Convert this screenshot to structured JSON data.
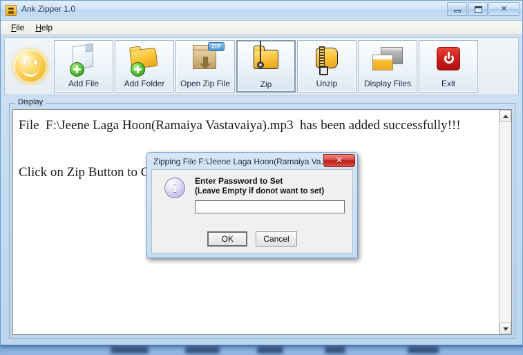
{
  "window": {
    "title": "Ank Zipper 1.0",
    "icon": "app-zipper-icon",
    "controls": {
      "minimize": "",
      "maximize": "",
      "close": "✕"
    }
  },
  "menu": {
    "items": [
      {
        "name": "file",
        "label": "File",
        "mnemonic": "F"
      },
      {
        "name": "help",
        "label": "Help",
        "mnemonic": "H"
      }
    ]
  },
  "toolbar": {
    "logo": "smiley-face-logo",
    "buttons": [
      {
        "name": "add-file",
        "label": "Add File",
        "icon": "add-file-icon"
      },
      {
        "name": "add-folder",
        "label": "Add Folder",
        "icon": "add-folder-icon"
      },
      {
        "name": "open-zip-file",
        "label": "Open Zip File",
        "icon": "open-zip-box-icon",
        "tag": "ZIP"
      },
      {
        "name": "zip",
        "label": "Zip",
        "icon": "zip-folder-icon",
        "focused": true
      },
      {
        "name": "unzip",
        "label": "Unzip",
        "icon": "unzip-bag-icon"
      },
      {
        "name": "display-files",
        "label": "Display Files",
        "icon": "display-files-icon"
      },
      {
        "name": "exit",
        "label": "Exit",
        "icon": "power-off-icon"
      }
    ]
  },
  "display": {
    "legend": "Display",
    "lines": [
      "File  F:\\Jeene Laga Hoon(Ramaiya Vastavaiya).mp3  has been added successfully!!!",
      "",
      "Click on Zip Button to Compress Files with Encryption"
    ],
    "text": "File  F:\\Jeene Laga Hoon(Ramaiya Vastavaiya).mp3  has been added successfully!!!\n\nClick on Zip Button to Compress Files with Encryption",
    "scrollbar": {
      "up": "▲",
      "down": "▼"
    }
  },
  "dialog": {
    "title": "Zipping File F:\\Jeene Laga Hoon(Ramaiya Va...",
    "close_label": "✕",
    "icon": "info-icon",
    "icon_glyph": "i",
    "message_line1": "Enter Password to Set",
    "message_line2": "(Leave Empty if donot want to set)",
    "password_value": "",
    "password_placeholder": "",
    "buttons": {
      "ok": "OK",
      "cancel": "Cancel"
    }
  },
  "colors": {
    "title_bar": "#cfe2f7",
    "window_frame": "#6a9bd0",
    "toolbar_bg": "#eef3f8",
    "exit_red": "#cc1f18",
    "dialog_close_red": "#d8453b",
    "info_icon": "#c8c4e8",
    "display_bg": "#ffffff"
  }
}
